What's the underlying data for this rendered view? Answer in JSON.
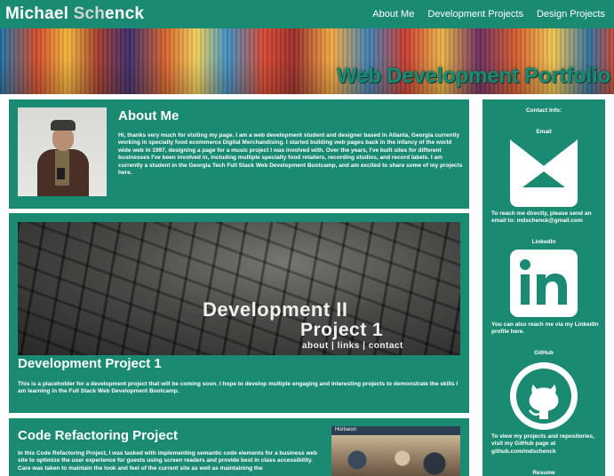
{
  "nav": {
    "brand_part1": "Michael ",
    "brand_part2": "Sch",
    "brand_part3": "enck",
    "links": [
      "About Me",
      "Development Projects",
      "Design Projects"
    ]
  },
  "hero": {
    "title": "Web Development Portfolio"
  },
  "about": {
    "title": "About Me",
    "text": "Hi, thanks very much for visiting my page. I am a web development student and designer based in Atlanta, Georgia currently working in specialty food ecommerce Digital Merchandising. I started building web pages back in the infancy of the world wide web in 1997, designing a page for a music project I was involved with. Over the years, I've built sites for different businesses I've been involved in, including multiple specialty food retailers, recording studios, and record labels. I am currently a student in the Georgia Tech Full Stack Web Development Bootcamp, and am excited to share some of my projects here."
  },
  "dev_project": {
    "image_line1": "Development II",
    "image_line2": "Project 1",
    "image_line3": "about | links | contact",
    "title": "Development Project 1",
    "text": "This is a placeholder for a development project that will be coming soon. I hope to develop multiple engaging and interesting projects to demonstrate the skills I am learning in the Full Stack Web Development Bootcamp."
  },
  "refactor_project": {
    "title": "Code Refactoring Project",
    "text": "In this Code Refactoring Project, I was tasked with implementing semantic code elements for a business web site to optimize the user experience for guests using screen readers and provide best in class accessibility. Care was taken to maintain the look and feel of the current site as well as maintaining the",
    "image_header": "Horiseon"
  },
  "sidebar": {
    "heading": "Contact Info:",
    "email_label": "Email",
    "email_text": "To reach me directly, please send an email to: mdschenck@gmail.com",
    "linkedin_label": "LinkedIn",
    "linkedin_text": "You can also reach me via my LinkedIn profile here.",
    "github_label": "GitHub",
    "github_text": "To view my projects and repositories, visit my GitHub page at github.com/mdschenck",
    "resume_label": "Resume"
  },
  "colors": {
    "accent": "#1b8a72",
    "text": "#ffffff",
    "background": "#ffffff"
  },
  "icons": [
    "envelope-icon",
    "linkedin-icon",
    "github-icon"
  ]
}
